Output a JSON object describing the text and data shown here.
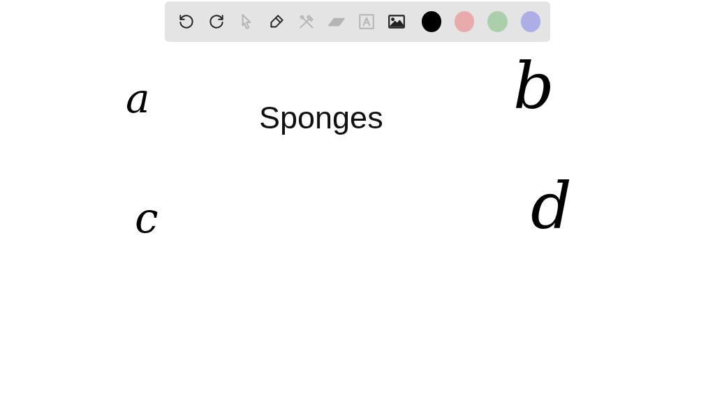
{
  "toolbar": {
    "tools": [
      {
        "kind": "undo",
        "disabled": false
      },
      {
        "kind": "redo",
        "disabled": false
      },
      {
        "kind": "pointer",
        "disabled": true
      },
      {
        "kind": "pen",
        "disabled": false
      },
      {
        "kind": "tools",
        "disabled": true
      },
      {
        "kind": "eraser",
        "disabled": true
      },
      {
        "kind": "text",
        "disabled": true
      },
      {
        "kind": "image",
        "disabled": false
      }
    ],
    "colors": [
      {
        "color": "#000000"
      },
      {
        "color": "#e8aaaa"
      },
      {
        "color": "#aacfaa"
      },
      {
        "color": "#aeaee6"
      }
    ]
  },
  "canvas": {
    "title": "Sponges",
    "handwriting": [
      {
        "text": "a"
      },
      {
        "text": "b"
      },
      {
        "text": "c"
      },
      {
        "text": "d"
      }
    ]
  }
}
